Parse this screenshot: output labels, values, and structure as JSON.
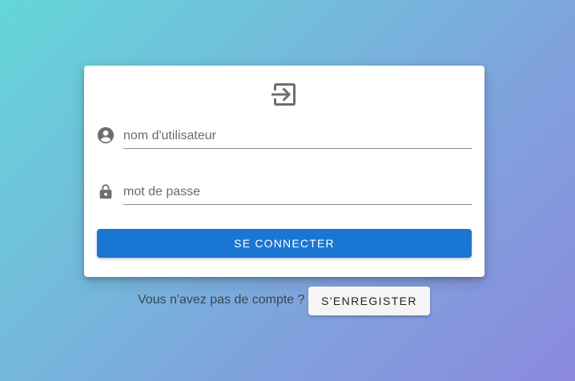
{
  "login_card": {
    "header_icon": "login-icon",
    "username": {
      "icon": "account-circle-icon",
      "placeholder": "nom d'utilisateur",
      "value": ""
    },
    "password": {
      "icon": "lock-icon",
      "placeholder": "mot de passe",
      "value": ""
    },
    "submit_label": "SE CONNECTER"
  },
  "signup": {
    "prompt": "Vous n'avez pas de compte ?",
    "button_label": "S'ENREGISTER"
  },
  "colors": {
    "primary": "#1976d2",
    "icon_gray": "#6e6e6e",
    "gradient_start": "#64d6d8",
    "gradient_end": "#8b89de"
  }
}
